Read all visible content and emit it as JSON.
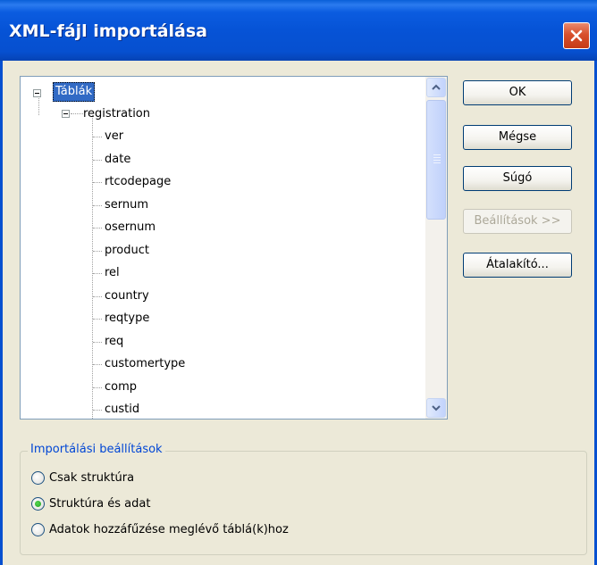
{
  "window": {
    "title": "XML-fájl importálása",
    "close_icon": "close-icon"
  },
  "tree": {
    "root_label": "Táblák",
    "node_label": "registration",
    "fields": [
      "ver",
      "date",
      "rtcodepage",
      "sernum",
      "osernum",
      "product",
      "rel",
      "country",
      "reqtype",
      "req",
      "customertype",
      "comp",
      "custid"
    ]
  },
  "buttons": {
    "ok": "OK",
    "cancel": "Mégse",
    "help": "Súgó",
    "settings": "Beállítások >>",
    "transform": "Átalakító..."
  },
  "import_options": {
    "legend": "Importálási beállítások",
    "options": [
      "Csak struktúra",
      "Struktúra és adat",
      "Adatok hozzáfűzése meglévő táblá(k)hoz"
    ],
    "selected_index": 1
  }
}
